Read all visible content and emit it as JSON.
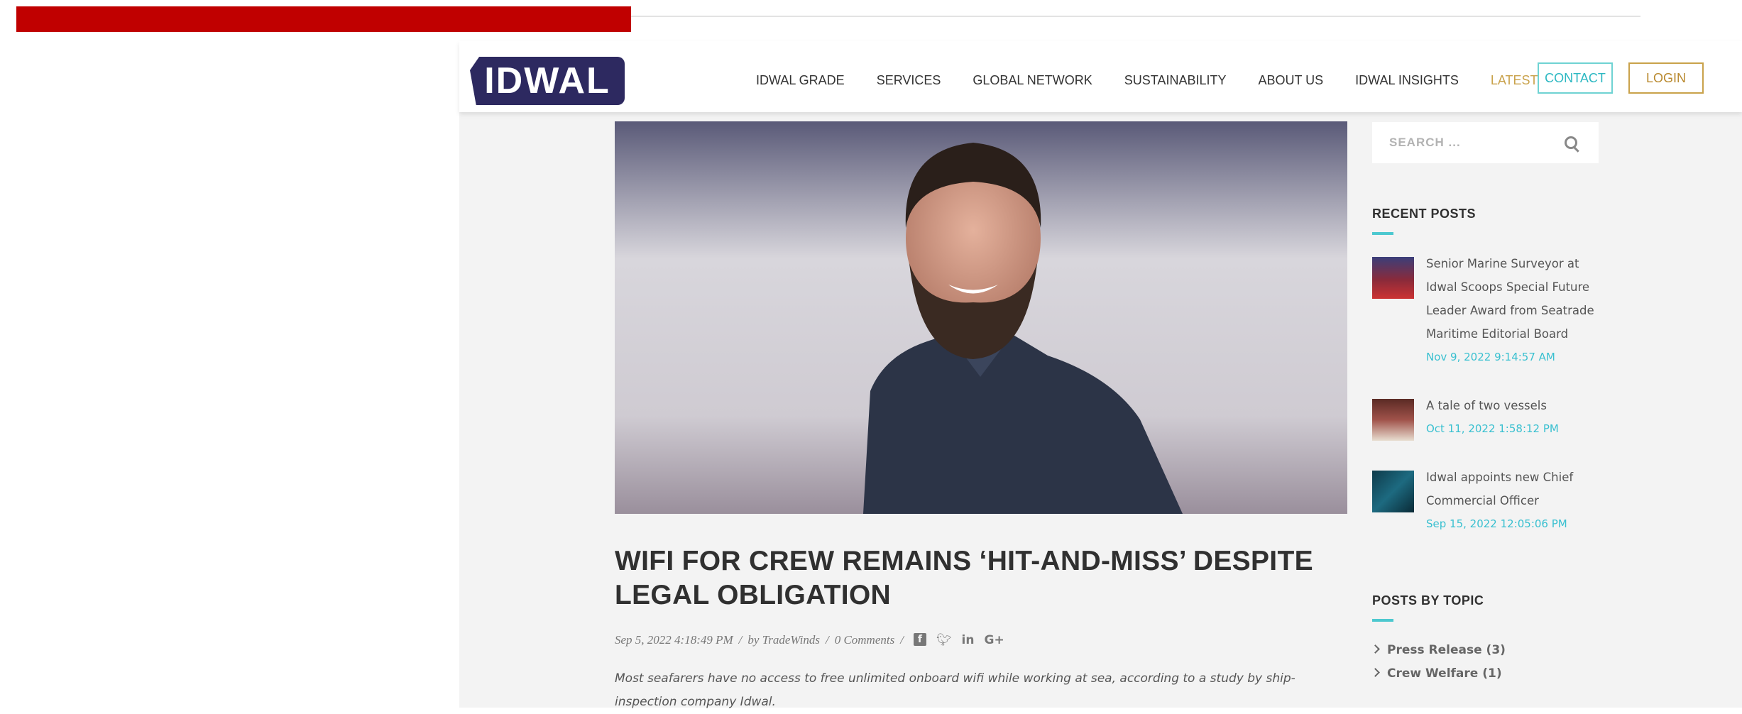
{
  "brand": {
    "logo_text": "IDWAL"
  },
  "nav": {
    "items": [
      "IDWAL GRADE",
      "SERVICES",
      "GLOBAL NETWORK",
      "SUSTAINABILITY",
      "ABOUT US",
      "IDWAL INSIGHTS",
      "LATEST"
    ],
    "contact_label": "CONTACT",
    "login_label": "LOGIN"
  },
  "article": {
    "title": "WIFI FOR CREW REMAINS ‘HIT-AND-MISS’ DESPITE LEGAL OBLIGATION",
    "date": "Sep 5, 2022 4:18:49 PM",
    "author": "by TradeWinds",
    "comments": "0 Comments",
    "excerpt": "Most seafarers have no access to free unlimited onboard wifi while working at sea, according to a study by ship-inspection company Idwal."
  },
  "sidebar": {
    "search_placeholder": "SEARCH ...",
    "recent_heading": "RECENT POSTS",
    "recent_posts": [
      {
        "title": "Senior Marine Surveyor at Idwal Scoops Special Future Leader Award from Seatrade Maritime Editorial Board",
        "date": "Nov 9, 2022 9:14:57 AM"
      },
      {
        "title": "A tale of two vessels",
        "date": "Oct 11, 2022 1:58:12 PM"
      },
      {
        "title": "Idwal appoints new Chief Commercial Officer",
        "date": "Sep 15, 2022 12:05:06 PM"
      }
    ],
    "topics_heading": "POSTS BY TOPIC",
    "topics": [
      "Press Release (3)",
      "Crew Welfare (1)"
    ]
  },
  "colors": {
    "brand_navy": "#2d2960",
    "accent_teal": "#4cc8cf",
    "accent_gold": "#c9a24b",
    "red_bar": "#c00000"
  }
}
